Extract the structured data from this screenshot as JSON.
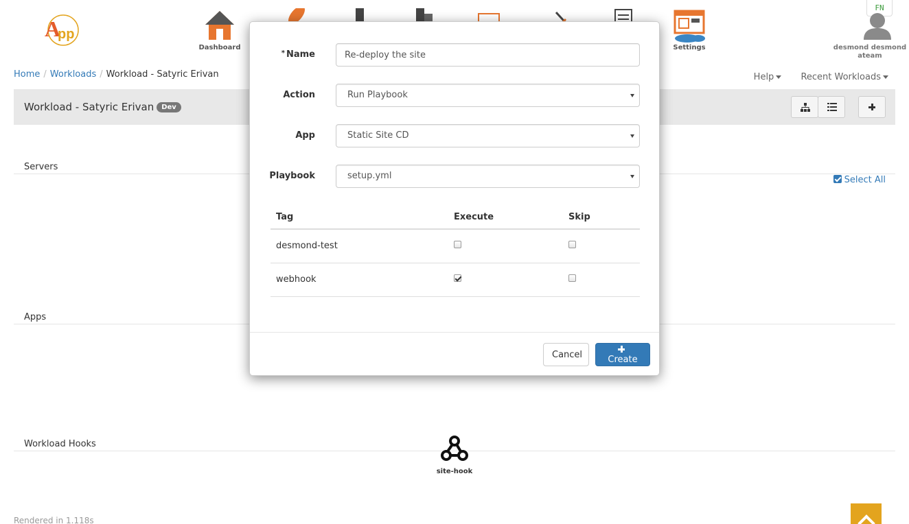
{
  "nav": {
    "items": [
      {
        "label": "Dashboard",
        "icon": "home-icon"
      },
      {
        "label": "",
        "icon": "rocket-icon"
      },
      {
        "label": "",
        "icon": "server-icon"
      },
      {
        "label": "",
        "icon": "servers-icon"
      },
      {
        "label": "",
        "icon": "windows-icon"
      },
      {
        "label": "",
        "icon": "tools-icon"
      },
      {
        "label": "",
        "icon": "documents-icon"
      },
      {
        "label": "Settings",
        "icon": "settings-icon"
      }
    ],
    "lang": "FN"
  },
  "user": {
    "name": "desmond desmond",
    "team": "ateam"
  },
  "breadcrumb": {
    "home": "Home",
    "workloads": "Workloads",
    "current": "Workload - Satyric Erivan"
  },
  "toplinks": {
    "help": "Help",
    "recent": "Recent Workloads"
  },
  "titlebar": {
    "title": "Workload - Satyric Erivan",
    "badge": "Dev"
  },
  "sections": {
    "servers": "Servers",
    "apps": "Apps",
    "hooks": "Workload Hooks",
    "select_all": "Select All"
  },
  "hook": {
    "label": "site-hook"
  },
  "footer": {
    "rendered": "Rendered in 1.118s"
  },
  "modal": {
    "name_label": "Name",
    "name_value": "Re-deploy the site",
    "action_label": "Action",
    "action_value": "Run Playbook",
    "app_label": "App",
    "app_value": "Static Site CD",
    "playbook_label": "Playbook",
    "playbook_value": "setup.yml",
    "table": {
      "headers": [
        "Tag",
        "Execute",
        "Skip"
      ],
      "rows": [
        {
          "tag": "desmond-test",
          "execute": false,
          "skip": false
        },
        {
          "tag": "webhook",
          "execute": true,
          "skip": false
        }
      ]
    },
    "cancel_label": "Cancel",
    "create_label": "Create"
  },
  "colors": {
    "primary": "#337ab7",
    "accent": "#e3a41e",
    "badge": "#777777"
  }
}
